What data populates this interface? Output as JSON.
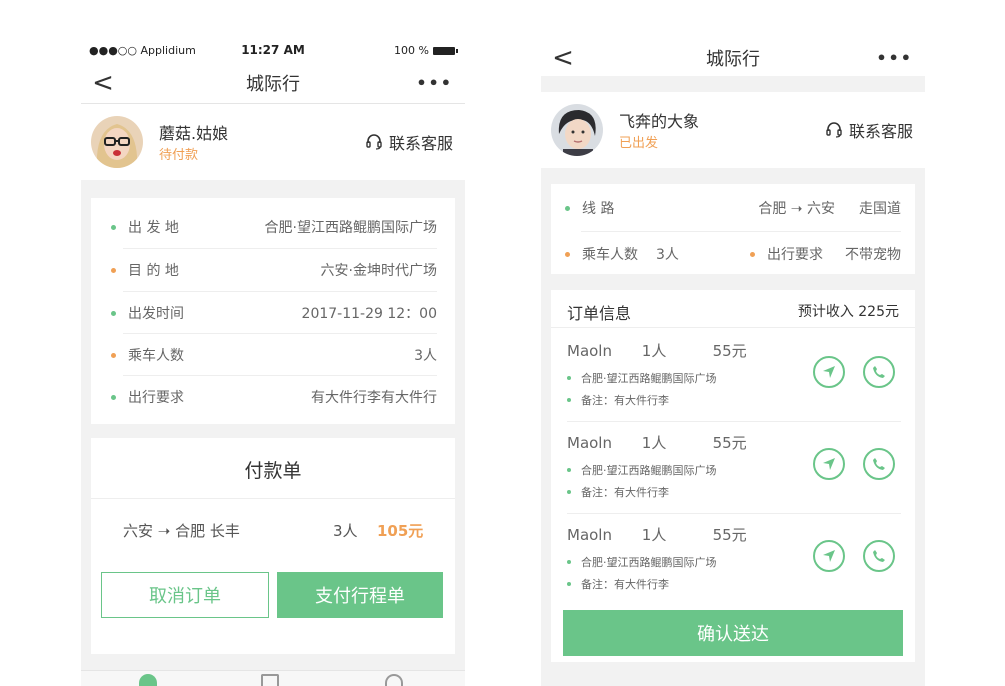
{
  "left": {
    "status": {
      "carrier": "●●●○○ Applidium",
      "time": "11:27 AM",
      "battery": "100 %"
    },
    "nav": {
      "back": "<",
      "title": "城际行",
      "more": "•••"
    },
    "user": {
      "name": "蘑菇.姑娘",
      "status": "待付款",
      "contact": "联系客服"
    },
    "details": [
      {
        "label": "出 发 地",
        "value": "合肥·望江西路鲲鹏国际广场",
        "dot": "green"
      },
      {
        "label": "目 的 地",
        "value": "六安·金坤时代广场",
        "dot": "orange"
      },
      {
        "label": "出发时间",
        "value": "2017-11-29 12：00",
        "dot": "green"
      },
      {
        "label": "乘车人数",
        "value": "3人",
        "dot": "orange"
      },
      {
        "label": "出行要求",
        "value": "有大件行李有大件行",
        "dot": "green"
      }
    ],
    "payment": {
      "title": "付款单",
      "route": "六安 ➝ 合肥 长丰",
      "count": "3人",
      "amount": "105元",
      "cancel_label": "取消订单",
      "pay_label": "支付行程单"
    }
  },
  "right": {
    "nav": {
      "back": "<",
      "title": "城际行",
      "more": "•••"
    },
    "user": {
      "name": "飞奔的大象",
      "status": "已出发",
      "contact": "联系客服"
    },
    "route": {
      "route_label": "线 路",
      "route_value": "合肥 ➝ 六安",
      "road": "走国道",
      "pax_label": "乘车人数",
      "pax_value": "3人",
      "req_label": "出行要求",
      "req_value": "不带宠物"
    },
    "orders": {
      "title": "订单信息",
      "income": "预计收入 225元",
      "items": [
        {
          "name": "Maoln",
          "pax": "1人",
          "fee": "55元",
          "address": "合肥·望江西路鲲鹏国际广场",
          "note": "备注：有大件行李"
        },
        {
          "name": "Maoln",
          "pax": "1人",
          "fee": "55元",
          "address": "合肥·望江西路鲲鹏国际广场",
          "note": "备注：有大件行李"
        },
        {
          "name": "Maoln",
          "pax": "1人",
          "fee": "55元",
          "address": "合肥·望江西路鲲鹏国际广场",
          "note": "备注：有大件行李"
        }
      ],
      "confirm_label": "确认送达"
    }
  },
  "colors": {
    "accent_green": "#6ac589",
    "accent_orange": "#f0a055"
  }
}
